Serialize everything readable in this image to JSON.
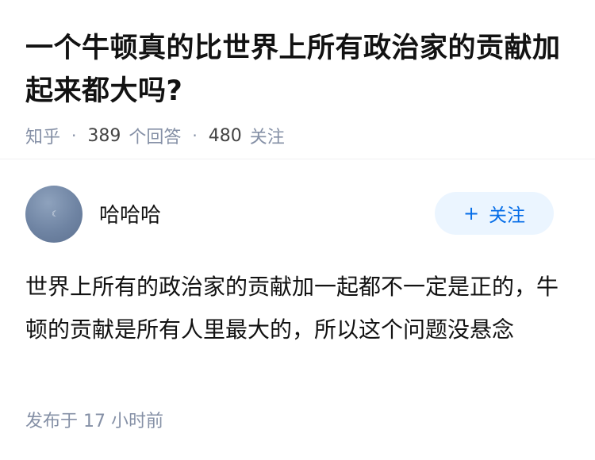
{
  "question": {
    "title": "一个牛顿真的比世界上所有政治家的贡献加起来都大吗?",
    "source": "知乎",
    "answer_count": "389",
    "answer_count_label": "个回答",
    "follower_count": "480",
    "follower_label": "关注",
    "separator": "·"
  },
  "answer": {
    "author_name": "哈哈哈",
    "follow_label": "关注",
    "follow_icon": "plus-icon",
    "content": "世界上所有的政治家的贡献加一起都不一定是正的，牛顿的贡献是所有人里最大的，所以这个问题没悬念",
    "time_prefix": "发布于",
    "time_value": "17 小时前"
  },
  "colors": {
    "accent": "#056de8",
    "follow_bg": "#ebf5ff",
    "meta_gray": "#8590a6",
    "text": "#121212"
  }
}
